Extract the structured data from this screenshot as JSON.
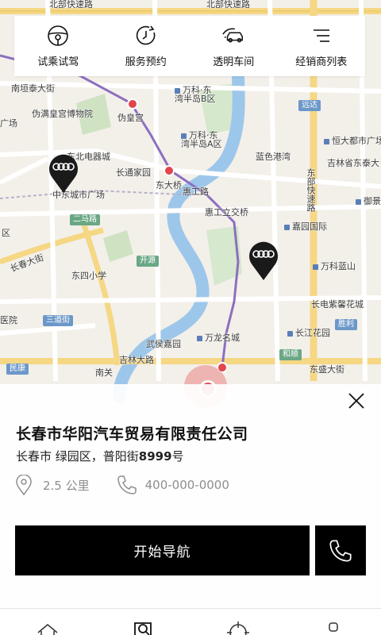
{
  "top_menu": [
    {
      "label": "试乘试驾",
      "icon": "steering-wheel-icon"
    },
    {
      "label": "服务预约",
      "icon": "clock-icon"
    },
    {
      "label": "透明车间",
      "icon": "car-garage-icon"
    },
    {
      "label": "经销商列表",
      "icon": "list-icon"
    }
  ],
  "map": {
    "labels": {
      "north_road_a": "北部快速路",
      "north_road_b": "北部快速路",
      "nanjing_street": "南垣泰大街",
      "weihuanggong": "伪满皇宫博物院",
      "weihuanggong_station": "伪皇宫",
      "guangchang": "广场",
      "vanke_b": "万科·东\n湾半岛B区",
      "vanke_a": "万科·东\n湾半岛A区",
      "dongbei_electric": "东北电器城",
      "zhongdong_plaza": "中东城市广场",
      "changtong_home": "长通家园",
      "dongdaqiao": "东大桥",
      "landiao_harbor": "蓝色港湾",
      "hengda_plaza": "恒大都市广场",
      "jilin_street": "吉林省东泰大",
      "yuan_west": "御景",
      "dongbu_fast": "东部快速路",
      "yanda_liqiao": "惠工立交桥",
      "huigong_road": "惠工路",
      "erma_road": "二马路",
      "dongsi_school": "东四小学",
      "kaiyuan": "开源",
      "changchun_street": "长春大街",
      "xinyuan": "嘉园国际",
      "vanke_lanshan": "万科蓝山",
      "changdian_garden": "长电紫馨花城",
      "wuxiang_road": "吉林大路",
      "donglong_street": "东盛大街",
      "wuhou_garden": "武侯嘉园",
      "wanlong_garden": "万龙名城",
      "changjiang_garden": "长江花园",
      "hospital": "医院",
      "sandao_street": "三道街",
      "qu": "区",
      "nanguan": "南关",
      "minkang": "民康",
      "heshun": "和顺",
      "erma": "二马路",
      "gongnong": "远达",
      "shengli": "胜利"
    }
  },
  "dealer": {
    "name": "长春市华阳汽车贸易有限责任公司",
    "address_prefix": "长春市 绿园区，普阳街",
    "address_number": "8999",
    "address_suffix": "号",
    "distance": "2.5 公里",
    "phone": "400-000-0000",
    "navigate_label": "开始导航"
  },
  "icons": {
    "close": "close-icon",
    "location": "location-pin-icon",
    "phone": "phone-icon",
    "dealer_pin": "audi-dealer-pin-icon"
  },
  "colors": {
    "primary": "#000000",
    "map_water": "#9dc7ea",
    "map_road": "#f5d784",
    "metro_line": "#8c6fbf",
    "metro_station": "#e0464b",
    "text_muted": "#8e8e8e"
  }
}
